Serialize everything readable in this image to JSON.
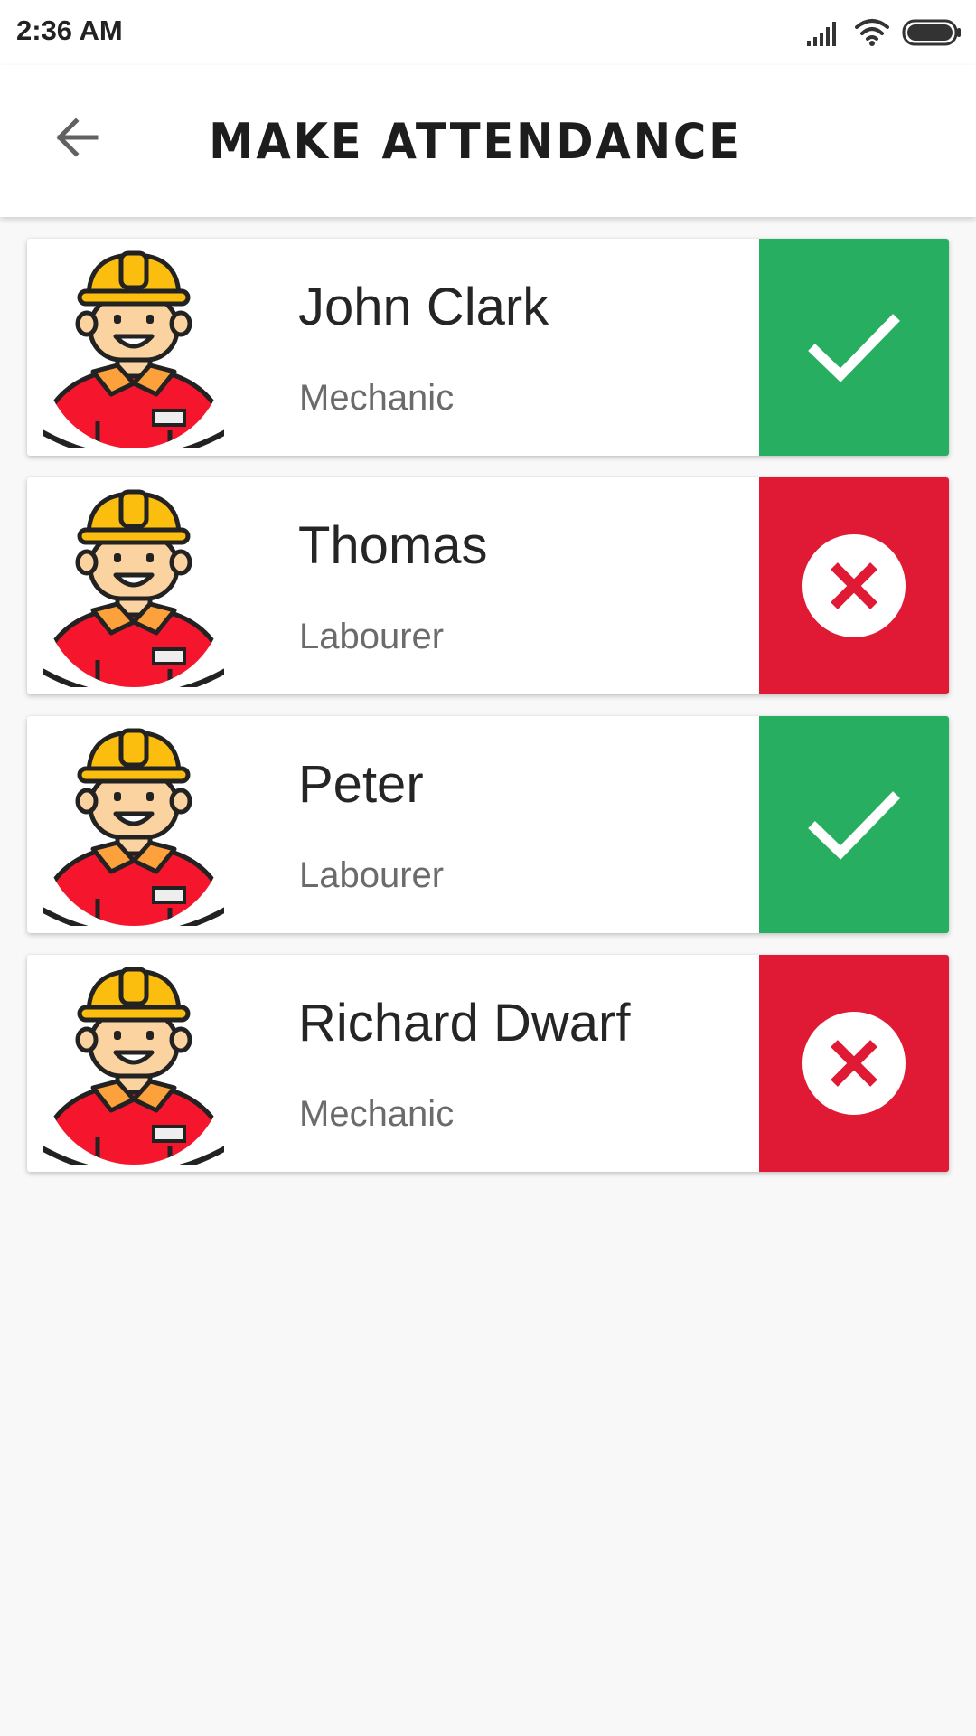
{
  "status_bar": {
    "time": "2:36 AM",
    "icons": [
      "signal-icon",
      "wifi-icon",
      "battery-icon"
    ]
  },
  "app_bar": {
    "back_icon": "arrow-left-icon",
    "title": "MAKE ATTENDANCE"
  },
  "colors": {
    "present": "#27ae60",
    "absent": "#e01a34",
    "avatar_shirt": "#f5162d",
    "avatar_helmet": "#fbbd0e",
    "background": "#f8f8f8"
  },
  "workers": [
    {
      "name": "John Clark",
      "role": "Mechanic",
      "status": "present",
      "status_icon": "check-icon"
    },
    {
      "name": "Thomas",
      "role": "Labourer",
      "status": "absent",
      "status_icon": "close-circle-icon"
    },
    {
      "name": "Peter",
      "role": "Labourer",
      "status": "present",
      "status_icon": "check-icon"
    },
    {
      "name": "Richard Dwarf",
      "role": "Mechanic",
      "status": "absent",
      "status_icon": "close-circle-icon"
    }
  ]
}
